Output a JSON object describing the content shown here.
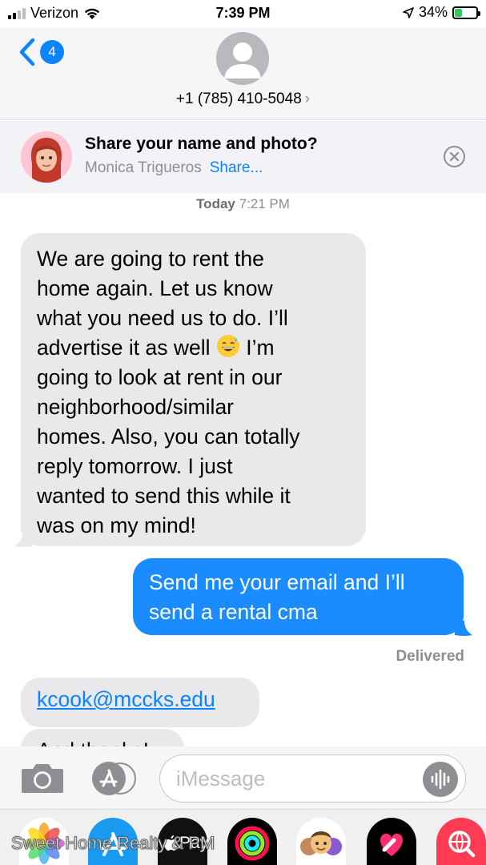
{
  "status_bar": {
    "carrier": "Verizon",
    "time": "7:39 PM",
    "battery_percent": "34%",
    "battery_level": 0.34,
    "signal_bars_active": 2,
    "signal_bars_total": 4
  },
  "header": {
    "back_badge": "4",
    "contact_number": "+1 (785) 410-5048",
    "contact_chevron": "›"
  },
  "share_banner": {
    "title": "Share your name and photo?",
    "name": "Monica Trigueros",
    "link": "Share..."
  },
  "conversation": {
    "timestamp_day": "Today",
    "timestamp_time": "7:21 PM",
    "incoming_message_lines": [
      "We are going to rent the",
      "home again. Let us know",
      "what you need us to do. I’ll",
      "advertise it as well",
      " I’m",
      "going to look at rent in our",
      "neighborhood/similar",
      "homes. Also, you can totally",
      "reply tomorrow. I just",
      "wanted to send this while it",
      "was on my mind!"
    ],
    "outgoing_message_lines": [
      "Send me your email and I’ll",
      "send a rental cma"
    ],
    "delivery_status": "Delivered",
    "email_message": "kcook@mccks.edu",
    "partial_message": "And thanks!"
  },
  "input_bar": {
    "placeholder": "iMessage"
  },
  "app_drawer": {
    "apps": [
      "photos-app",
      "app-store-app",
      "apple-pay-app",
      "activity-app",
      "memoji-app",
      "digital-touch-app",
      "web-search-app"
    ],
    "apple_pay_label": "Pay"
  },
  "watermark": "Sweet Home Realty & PM",
  "colors": {
    "ios_blue": "#0a84ff",
    "outgoing_bubble": "#1a8cff",
    "incoming_bubble": "#e9e9eb",
    "battery_green": "#34c759"
  }
}
